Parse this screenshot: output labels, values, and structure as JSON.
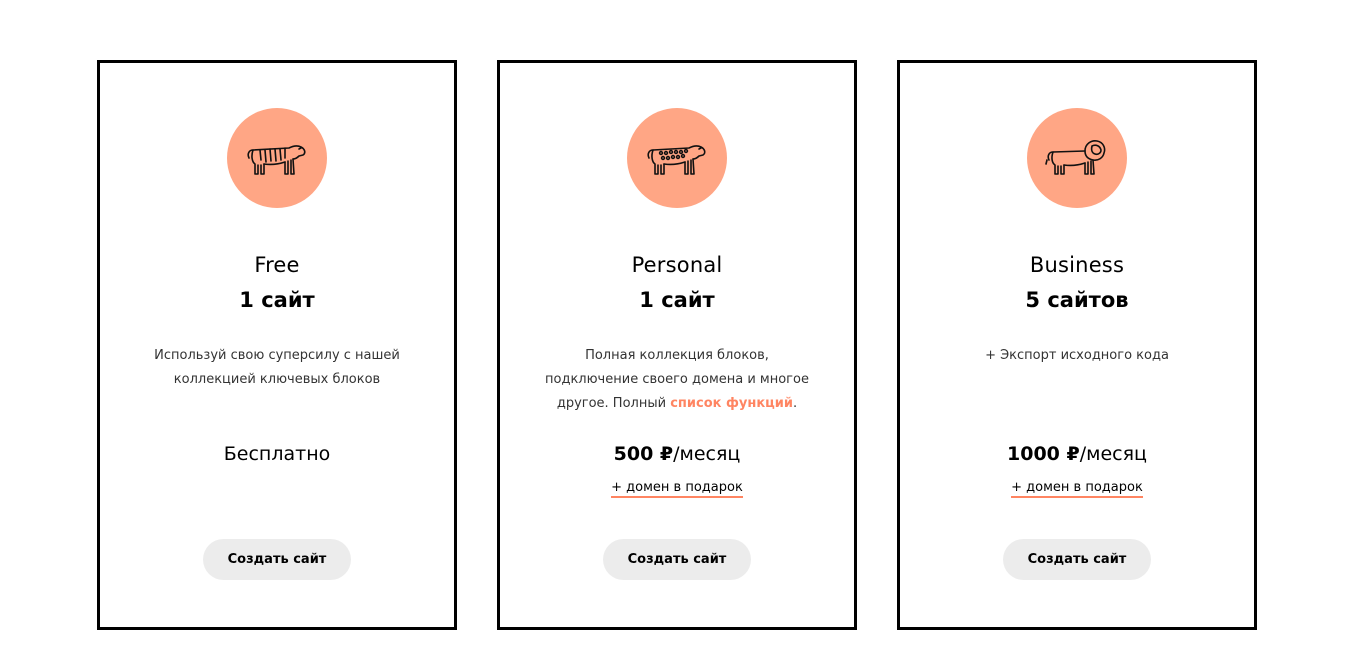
{
  "icon_color": "#ffa685",
  "accent_color": "#ff8562",
  "plans": [
    {
      "icon": "tiger-icon",
      "name": "Free",
      "sites": "1 сайт",
      "description": "Используй свою суперсилу с нашей коллекцией ключевых блоков",
      "price": "Бесплатно",
      "button": "Создать сайт"
    },
    {
      "icon": "leopard-icon",
      "name": "Personal",
      "sites": "1 сайт",
      "description": "Полная коллекция блоков, подключение своего домена и многое другое. Полный",
      "description_link": "список функций",
      "description_end": ".",
      "price_amount": "500 ₽",
      "price_period": "/месяц",
      "bonus": "+ домен в подарок",
      "button": "Создать сайт"
    },
    {
      "icon": "lion-icon",
      "name": "Business",
      "sites": "5 сайтов",
      "description": "+ Экспорт исходного кода",
      "price_amount": "1000 ₽",
      "price_period": "/месяц",
      "bonus": "+ домен в подарок",
      "button": "Создать сайт"
    }
  ]
}
